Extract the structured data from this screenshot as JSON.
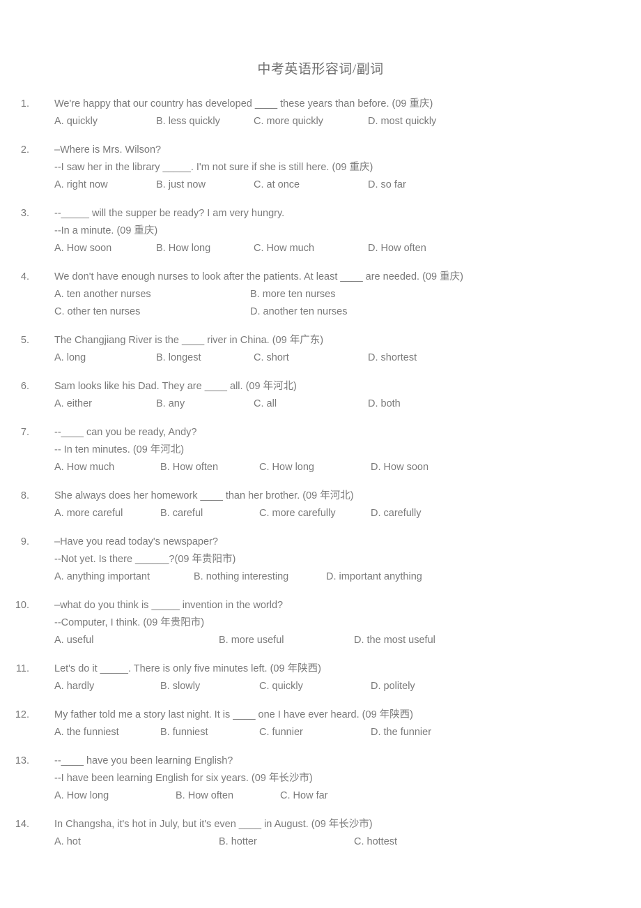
{
  "document": {
    "title": "中考英语形容词/副词"
  },
  "questions": [
    {
      "number": "1.",
      "lines": [
        "We're happy that our country has developed ____ these years than before. (09 重庆)"
      ],
      "layout": "cols-4",
      "options": [
        "A. quickly",
        "B. less quickly",
        "C. more quickly",
        "D. most quickly"
      ]
    },
    {
      "number": "2.",
      "lines": [
        "–Where is Mrs. Wilson?",
        "--I saw her in the library _____. I'm not sure if she is still here. (09 重庆)"
      ],
      "layout": "cols-4",
      "options": [
        "A. right now",
        "B. just now",
        "C. at once",
        "D. so far"
      ]
    },
    {
      "number": "3.",
      "lines": [
        "--_____ will the supper be ready? I am very hungry.",
        "--In a minute. (09 重庆)"
      ],
      "layout": "cols-4",
      "options": [
        "A. How soon",
        "B. How long",
        "C. How much",
        "D. How often"
      ]
    },
    {
      "number": "4.",
      "lines": [
        "We don't have enough nurses to look after the patients. At least ____ are needed. (09 重庆)"
      ],
      "layout": "cols-2",
      "options": [
        "A. ten another nurses",
        "B. more ten nurses",
        "C. other ten nurses",
        "D. another ten nurses"
      ]
    },
    {
      "number": "5.",
      "lines": [
        "The Changjiang River is the ____ river in China. (09 年广东)"
      ],
      "layout": "cols-4",
      "options": [
        "A. long",
        "B. longest",
        "C. short",
        "D. shortest"
      ]
    },
    {
      "number": "6.",
      "lines": [
        "Sam looks like his Dad. They are ____ all. (09 年河北)"
      ],
      "layout": "cols-4",
      "options": [
        "A. either",
        "B. any",
        "C. all",
        "D. both"
      ]
    },
    {
      "number": "7.",
      "lines": [
        "--____ can you be ready, Andy?",
        "-- In ten minutes. (09 年河北)"
      ],
      "layout": "cols-4b",
      "options": [
        "A. How much",
        "B. How often",
        "C. How long",
        "D. How soon"
      ]
    },
    {
      "number": "8.",
      "lines": [
        "She always does her homework ____ than her brother. (09 年河北)"
      ],
      "layout": "cols-4b",
      "options": [
        "A. more careful",
        "B. careful",
        "C. more carefully",
        "D. carefully"
      ]
    },
    {
      "number": "9.",
      "lines": [
        "–Have you read today's newspaper?",
        "--Not yet. Is there ______?(09 年贵阳市)"
      ],
      "layout": "cols-3",
      "options": [
        "A. anything important",
        "B. nothing interesting",
        "D. important anything"
      ]
    },
    {
      "number": "10.",
      "lines": [
        "–what do you think is _____ invention in the world?",
        "--Computer, I think. (09 年贵阳市)"
      ],
      "layout": "cols-3c",
      "options": [
        "A. useful",
        "B. more useful",
        "D. the most useful"
      ]
    },
    {
      "number": "11.",
      "lines": [
        "Let's do it _____. There is only five minutes left. (09 年陕西)"
      ],
      "layout": "cols-4b",
      "options": [
        "A. hardly",
        "B. slowly",
        "C. quickly",
        "D. politely"
      ]
    },
    {
      "number": "12.",
      "lines": [
        "My father told me a story last night. It is ____ one I have ever heard. (09 年陕西)"
      ],
      "layout": "cols-4b",
      "options": [
        "A. the funniest",
        "B. funniest",
        "C. funnier",
        "D. the funnier"
      ]
    },
    {
      "number": "13.",
      "lines": [
        "--____ have you been learning English?",
        "--I have been learning English for six years. (09 年长沙市)"
      ],
      "layout": "cols-3b",
      "options": [
        "A. How long",
        "B. How often",
        "C. How far"
      ]
    },
    {
      "number": "14.",
      "lines": [
        "In Changsha, it's hot in July, but it's even ____ in August. (09 年长沙市)"
      ],
      "layout": "cols-3c",
      "options": [
        "A. hot",
        "B. hotter",
        "C. hottest"
      ]
    }
  ]
}
